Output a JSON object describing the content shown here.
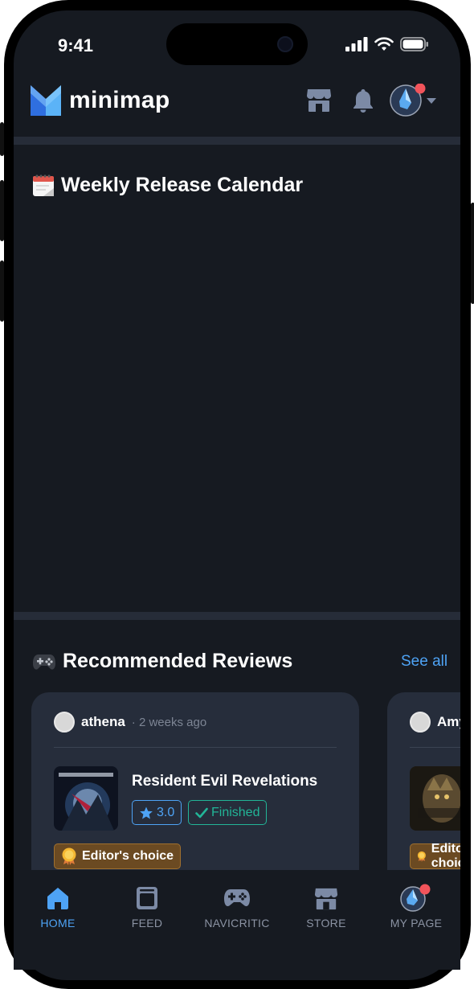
{
  "status_bar": {
    "time": "9:41"
  },
  "header": {
    "app_name": "minimap"
  },
  "calendar": {
    "title": "Weekly Release Calendar"
  },
  "reviews": {
    "title": "Recommended Reviews",
    "see_all": "See all",
    "cards": [
      {
        "username": "athena",
        "time": "· 2 weeks ago",
        "game_title": "Resident Evil Revelations",
        "rating": "3.0",
        "status": "Finished",
        "badge": "Editor's choice"
      },
      {
        "username": "Amy",
        "time": "",
        "game_title": "",
        "rating": "",
        "status": "",
        "badge": "Editor's choice"
      }
    ]
  },
  "tabs": [
    {
      "label": "HOME",
      "icon": "home-icon",
      "active": true
    },
    {
      "label": "FEED",
      "icon": "feed-icon",
      "active": false
    },
    {
      "label": "NAVICRITIC",
      "icon": "gamepad-icon",
      "active": false
    },
    {
      "label": "STORE",
      "icon": "store-icon",
      "active": false
    },
    {
      "label": "MY PAGE",
      "icon": "avatar-icon",
      "active": false
    }
  ],
  "colors": {
    "background": "#161a21",
    "card": "#262d3b",
    "accent": "#4ea3f5",
    "finished": "#22b597",
    "notification": "#f2545b"
  }
}
